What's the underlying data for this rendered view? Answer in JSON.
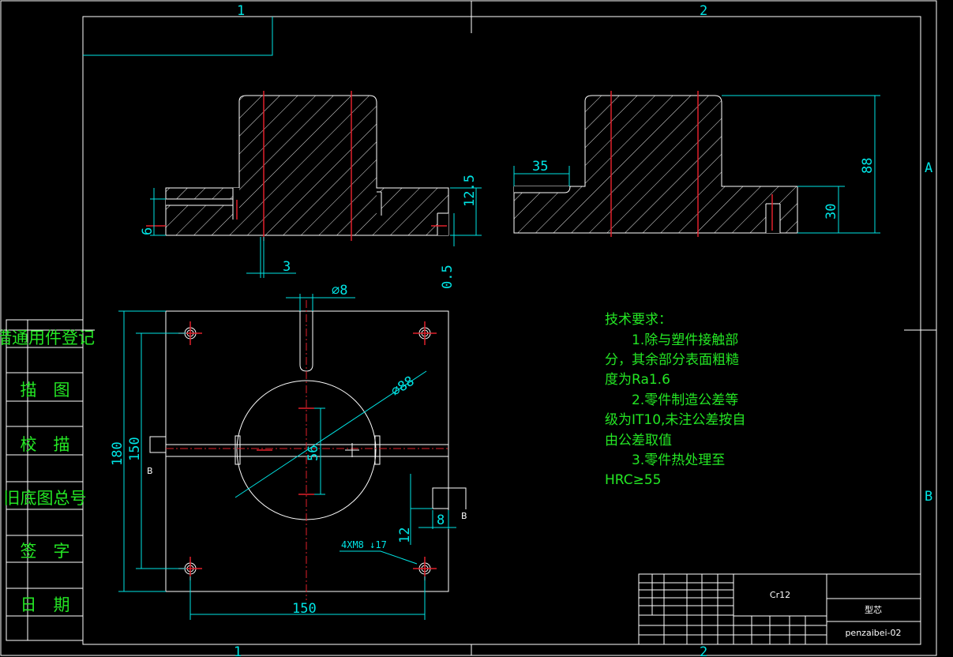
{
  "zones": {
    "col1": "1",
    "col2": "2",
    "rowA": "A",
    "rowB": "B"
  },
  "side_table": [
    "借通用件登记",
    "描　图",
    "校　描",
    "旧底图总号",
    "签　字",
    "日　期"
  ],
  "dims": {
    "d6": "6",
    "d3": "3",
    "d12_5": "12.5",
    "d0_5": "0.5",
    "d35": "35",
    "d88": "88",
    "d30": "30",
    "phi8": "⌀8",
    "phi88": "⌀88",
    "d56": "56",
    "d180": "180",
    "d150v": "150",
    "d150h": "150",
    "d12": "12",
    "d8": "8",
    "hole_note": "4XM8 ↓17",
    "sec_B1": "B",
    "sec_B2": "B"
  },
  "tech": {
    "title": "技术要求：",
    "lines": [
      "　　1.除与塑件接触部",
      "分，其余部分表面粗糙",
      "度为Ra1.6",
      "　　2.零件制造公差等",
      "级为IT10,未注公差按自",
      "由公差取值",
      "　　3.零件热处理至",
      "HRC≥55"
    ]
  },
  "title_block": {
    "material": "Cr12",
    "part_name": "型芯",
    "drawing_no": "penzaibei-02"
  }
}
